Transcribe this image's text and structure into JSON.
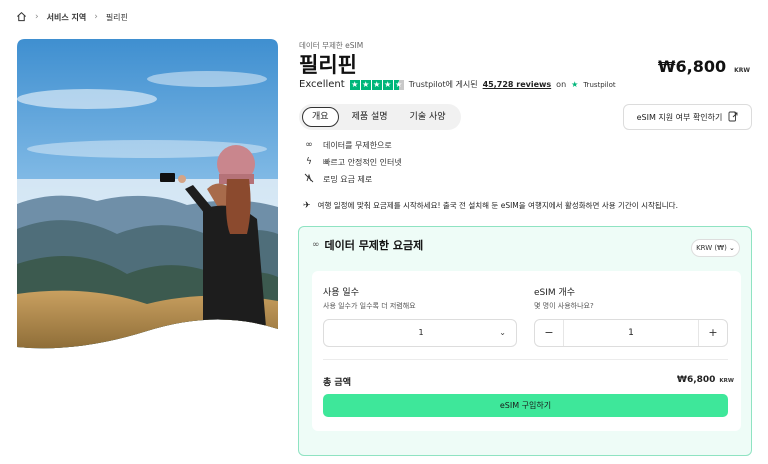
{
  "breadcrumb": {
    "home_icon": "home-icon",
    "items": [
      "서비스 지역",
      "필리핀"
    ]
  },
  "product": {
    "subtitle": "데이터 무제한 eSIM",
    "title": "필리핀",
    "rating_text": "Excellent",
    "rating_stars": 4.5,
    "trustpilot_prefix": "Trustpilot에 게시된",
    "reviews": "45,728 reviews",
    "on_text": "on",
    "trustpilot_name": "Trustpilot",
    "price": "₩6,800",
    "currency": "KRW"
  },
  "tabs": [
    {
      "label": "개요",
      "active": true
    },
    {
      "label": "제품 설명",
      "active": false
    },
    {
      "label": "기술 사양",
      "active": false
    }
  ],
  "check_button": {
    "label": "eSIM 지원 여부 확인하기",
    "icon": "external-check-icon"
  },
  "features": [
    {
      "icon": "infinity-icon",
      "text": "데이터를 무제한으로"
    },
    {
      "icon": "bolt-icon",
      "text": "빠르고 안정적인 인터넷"
    },
    {
      "icon": "no-roaming-icon",
      "text": "로밍 요금 제로"
    }
  ],
  "notice": {
    "icon": "plane-icon",
    "text": "여행 일정에 맞춰 요금제를 시작하세요! 출국 전 설치해 둔 eSIM을 여행지에서 활성화하면 사용 기간이 시작됩니다."
  },
  "plan": {
    "title": "데이터 무제한 요금제",
    "currency_select": "KRW (₩)",
    "days_label": "사용 일수",
    "days_hint": "사용 일수가 일수록 더 저렴해요",
    "days_value": "1",
    "esim_label": "eSIM 개수",
    "esim_hint": "몇 명이 사용하나요?",
    "esim_value": "1",
    "minus": "−",
    "plus": "+",
    "total_label": "총 금액",
    "total_price": "₩6,800",
    "total_currency": "KRW",
    "buy_label": "eSIM 구입하기"
  },
  "colors": {
    "accent": "#3ee79a",
    "card_bg": "#eefcf7",
    "card_border": "#8fe3c2",
    "trustpilot": "#00b67a"
  }
}
